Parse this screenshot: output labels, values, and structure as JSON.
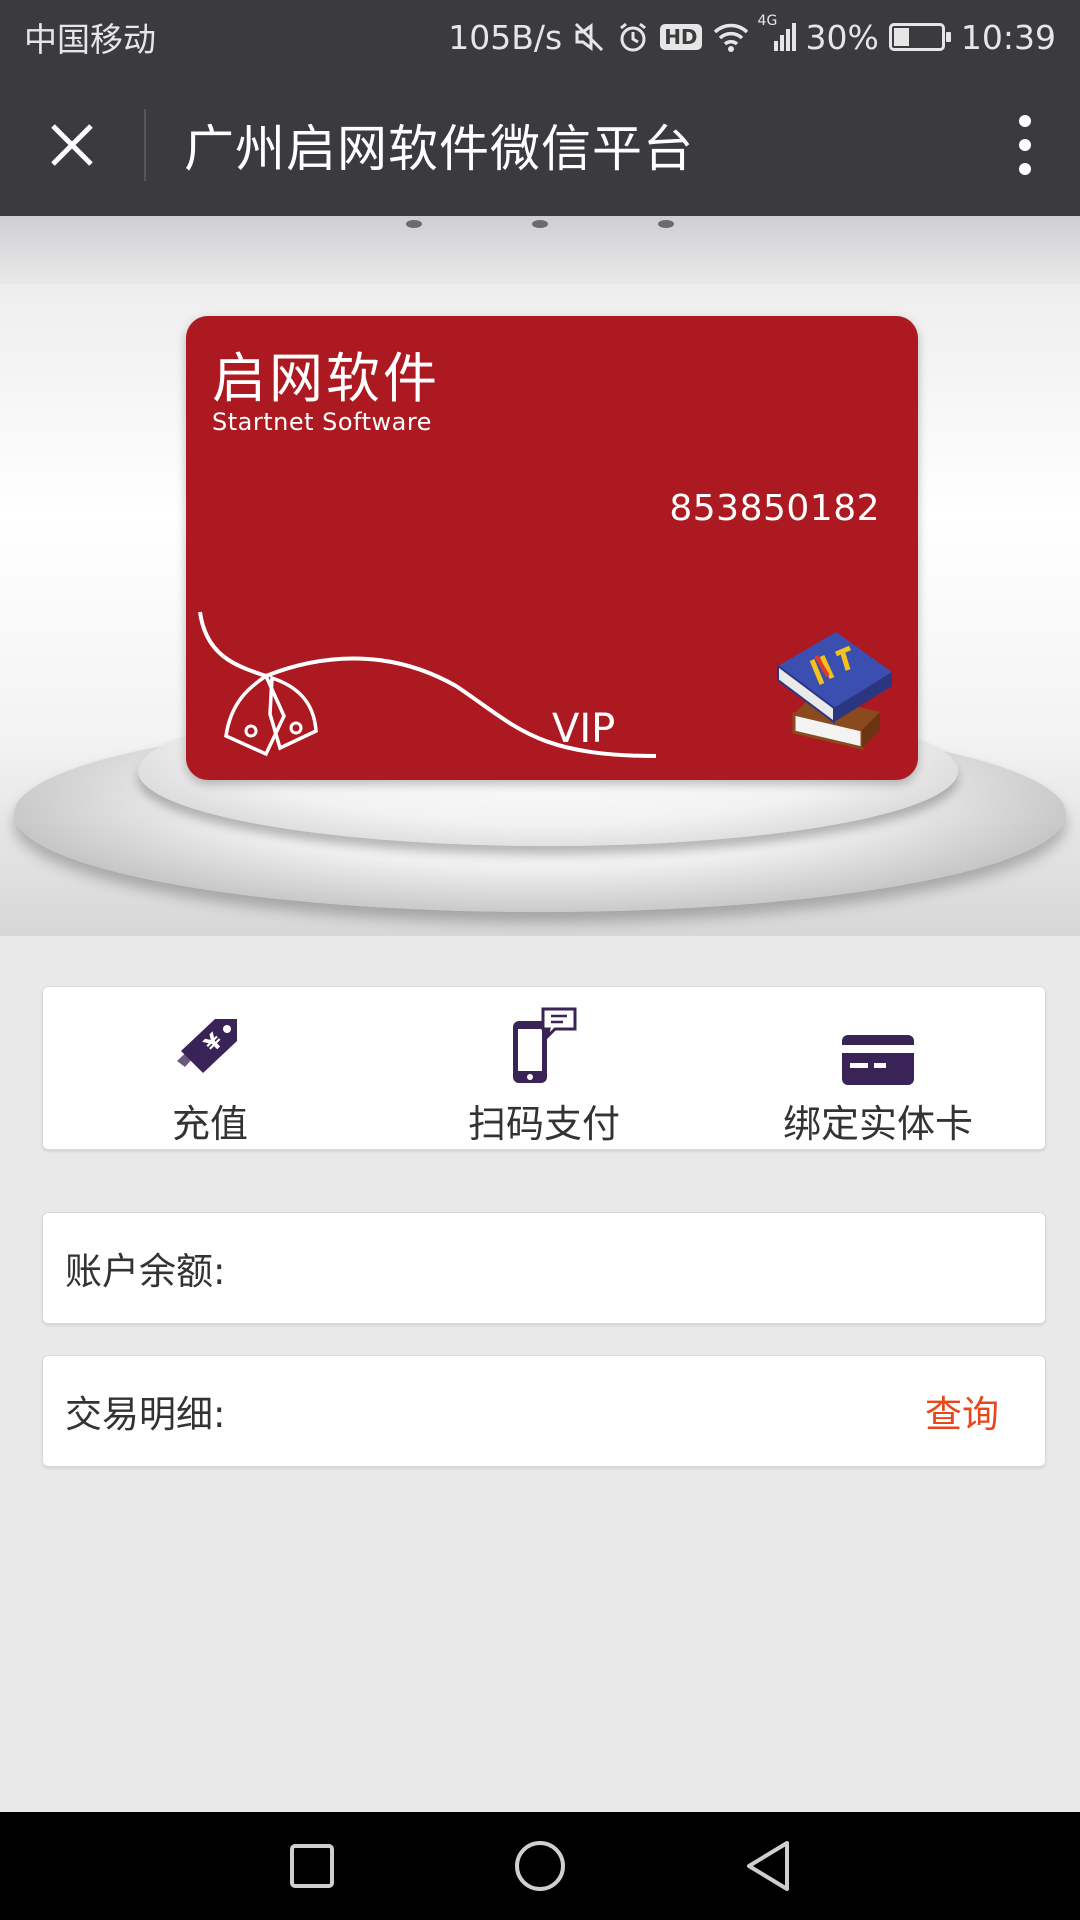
{
  "status_bar": {
    "carrier": "中国移动",
    "net_speed": "105B/s",
    "network_type": "4G",
    "hd_badge": "HD",
    "battery_percent": "30%",
    "battery_level": 0.3,
    "time": "10:39"
  },
  "title_bar": {
    "title": "广州启网软件微信平台"
  },
  "card": {
    "brand": "启网软件",
    "brand_en": "Startnet Software",
    "number": "853850182",
    "tier": "VIP",
    "color": "#ad1920"
  },
  "actions": [
    {
      "label": "充值",
      "icon": "price-tag-icon"
    },
    {
      "label": "扫码支付",
      "icon": "phone-scan-icon"
    },
    {
      "label": "绑定实体卡",
      "icon": "credit-card-icon"
    }
  ],
  "account": {
    "balance_label": "账户余额:",
    "transactions_label": "交易明细:",
    "query_link": "查询"
  },
  "colors": {
    "header": "#3b3b3f",
    "link": "#e8471c",
    "icon": "#3a2356"
  }
}
